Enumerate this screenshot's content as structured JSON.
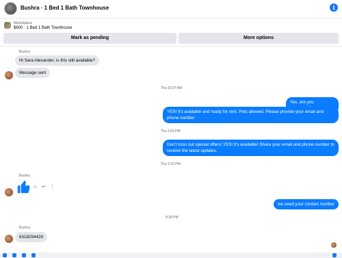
{
  "header": {
    "title": "Bushra · 1 Bed 1 Bath Townhouse",
    "info_icon": "info-icon"
  },
  "listing": {
    "label": "Marketplace",
    "name": "$600 · 1 Bed 1 Bath Townhouse"
  },
  "actions": {
    "pending": "Mark as pending",
    "more": "More options"
  },
  "messages": {
    "sender1": "Bushra",
    "in1": "Hi Sara Alexander, is this still available?",
    "in2": "Message sent",
    "ts1": "Thu 10:27 AM",
    "out1": "Yes, are you interested?",
    "out2": "YES! it's available and ready for rent. Pets allowed. Please provide your email and phone number",
    "ts2": "Thu 2:02 PM",
    "out3": "Don't miss out special offers! YES! it's available! Share your email and phone number to receive the latest updates.",
    "ts3": "Thu 2:23 PM",
    "sender2": "Bushra",
    "out4": "we need your contact number",
    "ts4": "8:39 PM",
    "sender3": "Bushra",
    "in3": "6318294428"
  }
}
